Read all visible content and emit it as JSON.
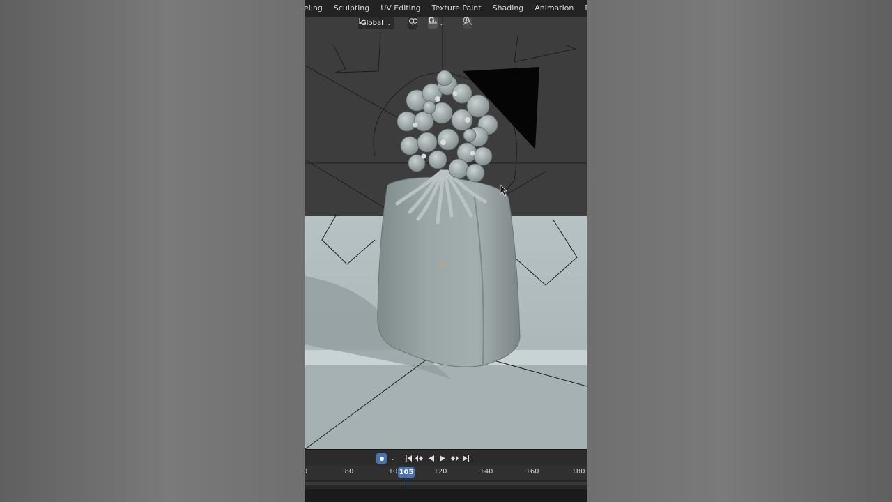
{
  "workspace_tabs": [
    "eling",
    "Sculpting",
    "UV Editing",
    "Texture Paint",
    "Shading",
    "Animation",
    "Rendering"
  ],
  "viewport_header": {
    "orientation_label": "Global",
    "orientation_icon": "transform-orientation-icon",
    "pivot_icon": "pivot-icon",
    "snap_icon": "snap-magnet-icon",
    "snap_target_icon": "snap-increment-icon",
    "proportional_icon": "proportional-edit-icon",
    "falloff_icon": "falloff-curve-icon"
  },
  "timeline": {
    "current_frame": "105",
    "ticks": [
      "0",
      "80",
      "10",
      "120",
      "140",
      "160",
      "180"
    ],
    "controls": [
      "record-icon",
      "jump-start-icon",
      "prev-keyframe-icon",
      "play-reverse-icon",
      "play-icon",
      "next-keyframe-icon",
      "jump-end-icon"
    ]
  },
  "colors": {
    "accent": "#4772b3",
    "floor": "#a9b6b8",
    "object": "#9aa6a6",
    "background_wall": "#3c3c3c"
  }
}
